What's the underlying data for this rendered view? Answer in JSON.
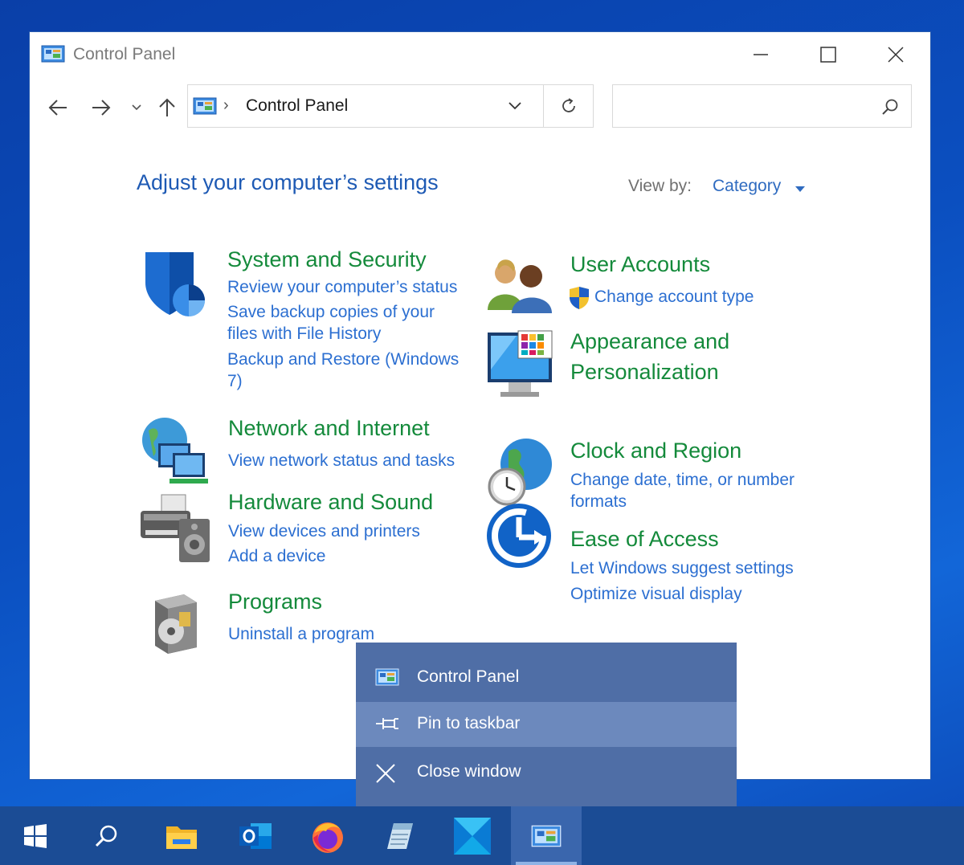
{
  "window": {
    "title": "Control Panel"
  },
  "address_bar": {
    "path": "Control Panel",
    "separator": "›"
  },
  "search": {
    "placeholder": ""
  },
  "main": {
    "heading": "Adjust your computer’s settings",
    "view_by_label": "View by:",
    "view_by_value": "Category"
  },
  "categories": {
    "system_security": {
      "title": "System and Security",
      "links": [
        "Review your computer’s status",
        "Save backup copies of your",
        "files with File History",
        "Backup and Restore (Windows",
        "7)"
      ]
    },
    "network": {
      "title": "Network and Internet",
      "links": [
        "View network status and tasks"
      ]
    },
    "hardware": {
      "title": "Hardware and Sound",
      "links": [
        "View devices and printers",
        "Add a device"
      ]
    },
    "programs": {
      "title": "Programs",
      "links": [
        "Uninstall a program"
      ]
    },
    "user_accounts": {
      "title": "User Accounts",
      "links": [
        "Change account type"
      ]
    },
    "appearance": {
      "title_line1": "Appearance and",
      "title_line2": "Personalization"
    },
    "clock": {
      "title": "Clock and Region",
      "links": [
        "Change date, time, or number",
        "formats"
      ]
    },
    "ease": {
      "title": "Ease of Access",
      "links": [
        "Let Windows suggest settings",
        "Optimize visual display"
      ]
    }
  },
  "jumplist": {
    "items": [
      {
        "label": "Control Panel",
        "icon": "control-panel-icon"
      },
      {
        "label": "Pin to taskbar",
        "icon": "pin-icon"
      },
      {
        "label": "Close window",
        "icon": "close-icon"
      }
    ]
  },
  "taskbar": {
    "items": [
      "start-icon",
      "search-icon",
      "file-explorer-icon",
      "outlook-icon",
      "firefox-icon",
      "notepad-icon",
      "app-icon",
      "control-panel-icon"
    ]
  },
  "colors": {
    "link": "#2c6fd1",
    "category_title": "#148a3b",
    "heading": "#1e5ab4",
    "taskbar": "#1b4c95",
    "jumplist": "#4f6ea6"
  }
}
